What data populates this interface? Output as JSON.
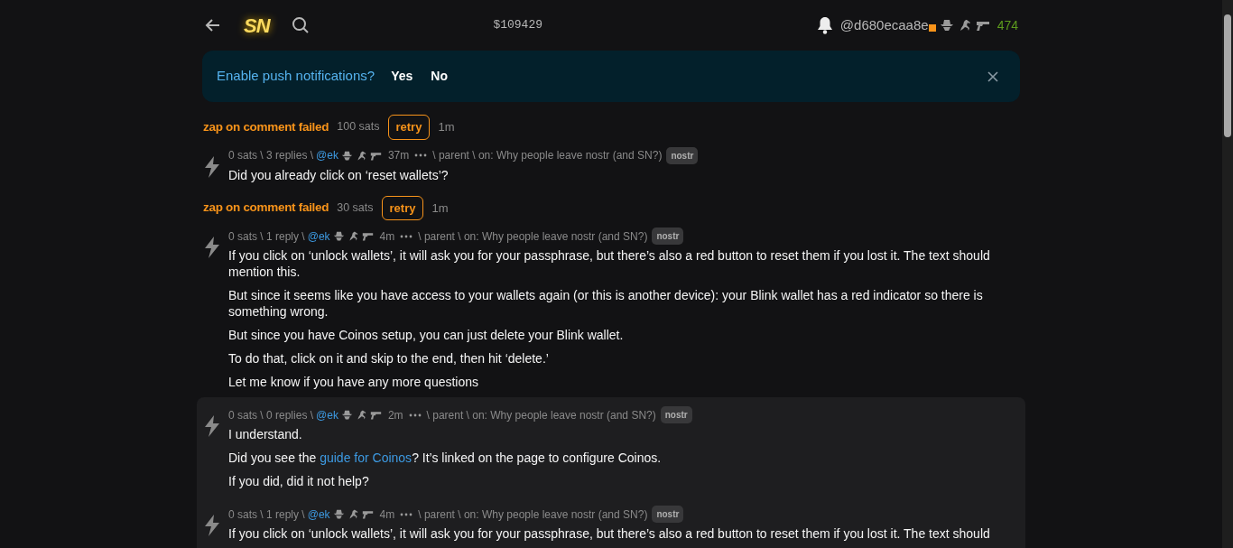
{
  "navbar": {
    "logo": "SN",
    "price": "$109429",
    "username": "@d680ecaa8e",
    "has_new": true,
    "sats": "474"
  },
  "alert": {
    "text": "Enable push notifications?",
    "buttons": [
      "Yes",
      "No"
    ]
  },
  "feed": [
    {
      "kind": "zap_failed",
      "title": "zap on comment failed",
      "amount": "100 sats",
      "button": "retry",
      "time": "1m"
    },
    {
      "kind": "comment",
      "highlighted": false,
      "stats": "0 sats \\ 3 replies \\",
      "user": "@ek",
      "time": "37m",
      "trail": "\\ parent \\ on: Why people leave nostr (and SN?)",
      "tag": "nostr",
      "paragraphs": [
        "Did you already click on ‘reset wallets’?"
      ]
    },
    {
      "kind": "zap_failed",
      "title": "zap on comment failed",
      "amount": "30 sats",
      "button": "retry",
      "time": "1m"
    },
    {
      "kind": "comment",
      "highlighted": false,
      "stats": "0 sats \\ 1 reply \\",
      "user": "@ek",
      "time": "4m",
      "trail": "\\ parent \\ on: Why people leave nostr (and SN?)",
      "tag": "nostr",
      "paragraphs": [
        "If you click on ‘unlock wallets’, it will ask you for your passphrase, but there’s also a red button to reset them if you lost it. The text should mention this.",
        "But since it seems like you have access to your wallets again (or this is another device): your Blink wallet has a red indicator so there is something wrong.",
        "But since you have Coinos setup, you can just delete your Blink wallet.",
        "To do that, click on it and skip to the end, then hit ‘delete.’",
        "Let me know if you have any more questions"
      ]
    },
    {
      "kind": "comment",
      "highlighted": true,
      "stats": "0 sats \\ 0 replies \\",
      "user": "@ek",
      "time": "2m",
      "trail": "\\ parent \\ on: Why people leave nostr (and SN?)",
      "tag": "nostr",
      "paragraphs": [
        "I understand.",
        [
          {
            "text": "Did you see the "
          },
          {
            "text": "guide for Coinos",
            "link": true
          },
          {
            "text": "? It’s linked on the page to configure Coinos."
          }
        ],
        "If you did, did it not help?"
      ]
    },
    {
      "kind": "comment",
      "highlighted": true,
      "stats": "0 sats \\ 1 reply \\",
      "user": "@ek",
      "time": "4m",
      "trail": "\\ parent \\ on: Why people leave nostr (and SN?)",
      "tag": "nostr",
      "paragraphs": [
        "If you click on ‘unlock wallets’, it will ask you for your passphrase, but there’s also a red button to reset them if you lost it. The text should"
      ]
    }
  ]
}
